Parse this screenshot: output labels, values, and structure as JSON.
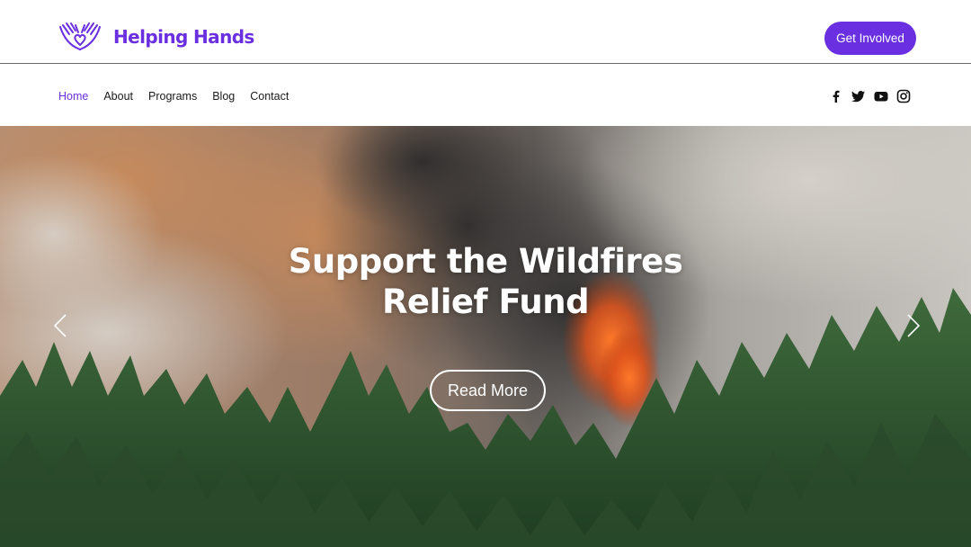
{
  "header": {
    "brand_name": "Helping Hands",
    "logo_icon": "hands-heart-logo-icon",
    "cta_label": "Get Involved"
  },
  "nav": {
    "items": [
      {
        "label": "Home",
        "active": true
      },
      {
        "label": "About",
        "active": false
      },
      {
        "label": "Programs",
        "active": false
      },
      {
        "label": "Blog",
        "active": false
      },
      {
        "label": "Contact",
        "active": false
      }
    ]
  },
  "social": {
    "icons": [
      "facebook-icon",
      "twitter-icon",
      "youtube-icon",
      "instagram-icon"
    ]
  },
  "hero": {
    "title_line1": "Support the Wildfires",
    "title_line2": "Relief Fund",
    "button_label": "Read More",
    "prev_icon": "chevron-left-icon",
    "next_icon": "chevron-right-icon",
    "background": "forest-wildfire-photo"
  },
  "colors": {
    "accent": "#6a2fe0",
    "text": "#1a1a1a",
    "white": "#ffffff"
  }
}
